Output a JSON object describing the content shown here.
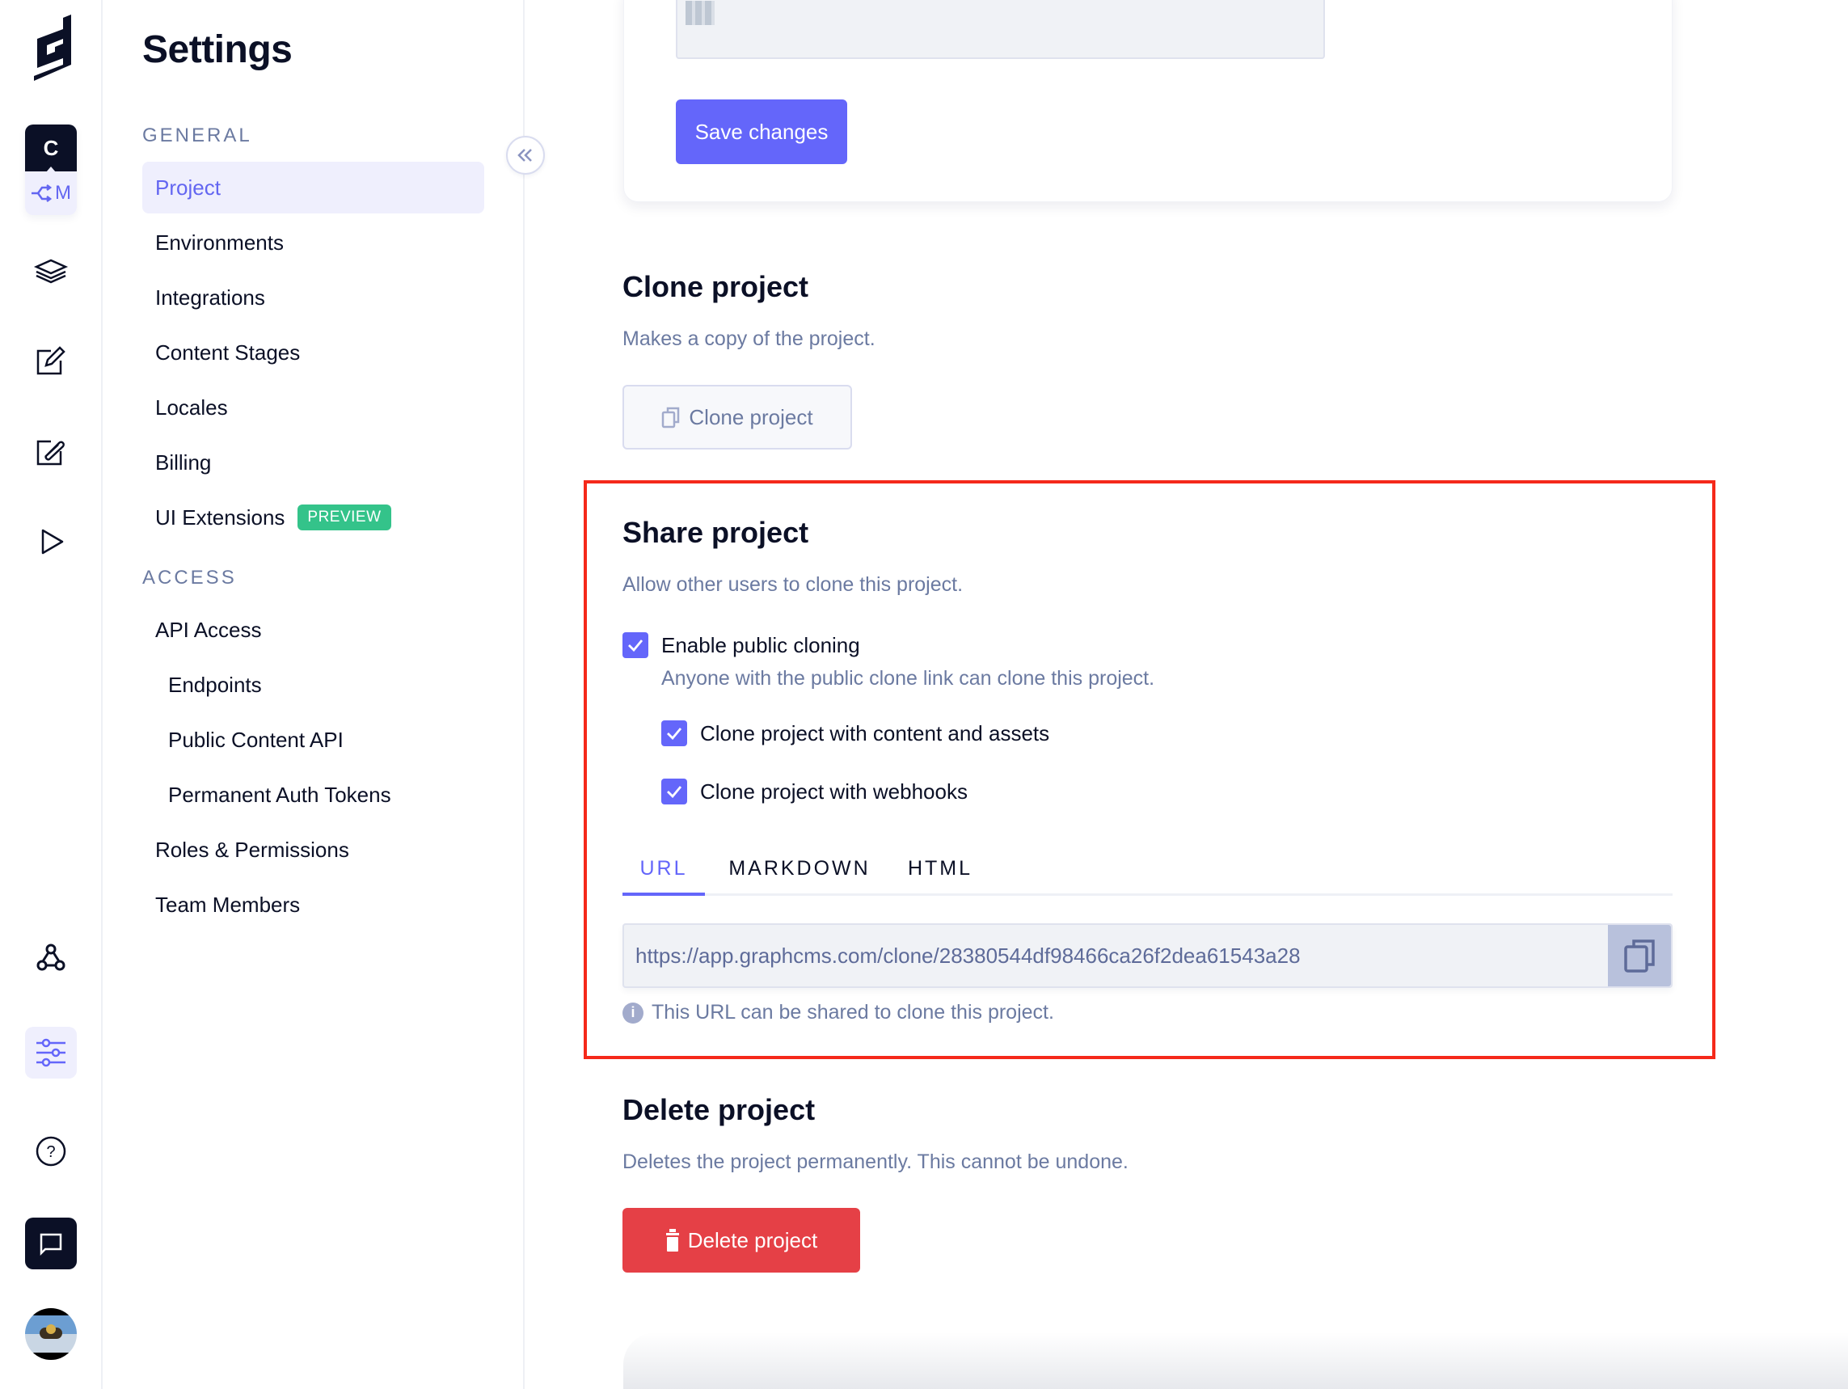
{
  "rail": {
    "project_initial": "C",
    "environment_initial": "M",
    "icons": [
      "logo-icon",
      "schema-layers-icon",
      "content-edit-icon",
      "assets-edit-icon",
      "playground-play-icon",
      "webhooks-icon",
      "settings-sliders-icon",
      "help-icon",
      "chat-icon",
      "user-avatar"
    ]
  },
  "sidebar": {
    "title": "Settings",
    "general_label": "GENERAL",
    "access_label": "ACCESS",
    "general_items": [
      {
        "label": "Project",
        "active": true
      },
      {
        "label": "Environments"
      },
      {
        "label": "Integrations"
      },
      {
        "label": "Content Stages"
      },
      {
        "label": "Locales"
      },
      {
        "label": "Billing"
      },
      {
        "label": "UI Extensions",
        "badge": "PREVIEW"
      }
    ],
    "access_items": [
      {
        "label": "API Access"
      },
      {
        "label": "Endpoints",
        "sub": true
      },
      {
        "label": "Public Content API",
        "sub": true
      },
      {
        "label": "Permanent Auth Tokens",
        "sub": true
      },
      {
        "label": "Roles & Permissions"
      },
      {
        "label": "Team Members"
      }
    ]
  },
  "main": {
    "save_button": "Save changes",
    "clone": {
      "title": "Clone project",
      "description": "Makes a copy of the project.",
      "button": "Clone project"
    },
    "share": {
      "title": "Share project",
      "description": "Allow other users to clone this project.",
      "enable_label": "Enable public cloning",
      "enable_checked": true,
      "enable_hint": "Anyone with the public clone link can clone this project.",
      "option_content": "Clone project with content and assets",
      "option_content_checked": true,
      "option_webhooks": "Clone project with webhooks",
      "option_webhooks_checked": true,
      "tabs": [
        "URL",
        "MARKDOWN",
        "HTML"
      ],
      "active_tab": "URL",
      "url_value": "https://app.graphcms.com/clone/28380544df98466ca26f2dea61543a28",
      "url_hint": "This URL can be shared to clone this project."
    },
    "delete": {
      "title": "Delete project",
      "description": "Deletes the project permanently. This cannot be undone.",
      "button": "Delete project"
    }
  },
  "colors": {
    "accent": "#6466fa",
    "danger": "#e54046",
    "highlight": "#f5291a",
    "badge": "#34c38a",
    "text_dark": "#0b1026",
    "text_muted": "#6b7aa1"
  }
}
